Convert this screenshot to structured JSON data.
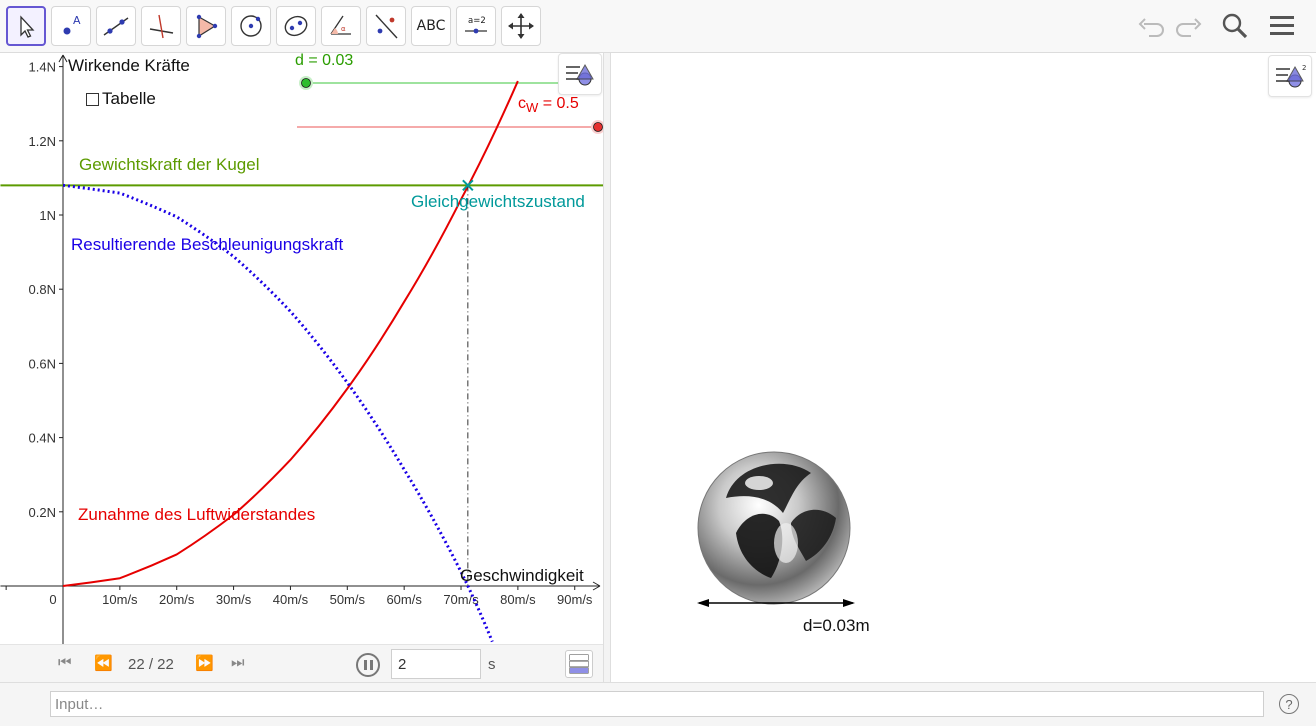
{
  "toolbar": {
    "tools": [
      {
        "name": "move-tool",
        "icon": "arrow-cursor-icon"
      },
      {
        "name": "point-tool",
        "icon": "point-icon",
        "label": "A"
      },
      {
        "name": "line-tool",
        "icon": "line-icon"
      },
      {
        "name": "perpendicular-line-tool",
        "icon": "perpendicular-line-icon"
      },
      {
        "name": "polygon-tool",
        "icon": "polygon-icon"
      },
      {
        "name": "circle-tool",
        "icon": "circle-icon"
      },
      {
        "name": "ellipse-tool",
        "icon": "ellipse-icon"
      },
      {
        "name": "angle-tool",
        "icon": "angle-icon"
      },
      {
        "name": "reflect-tool",
        "icon": "reflect-icon"
      },
      {
        "name": "text-tool",
        "icon": "text-icon",
        "label": "ABC"
      },
      {
        "name": "slider-tool",
        "icon": "slider-icon",
        "label": "a=2"
      },
      {
        "name": "move-graphics-view-tool",
        "icon": "move-view-icon"
      }
    ],
    "right": [
      "undo-icon",
      "redo-icon",
      "search-icon",
      "menu-icon"
    ]
  },
  "graphics1": {
    "title": "Wirkende Kräfte",
    "checkbox_label": "Tabelle",
    "checkbox_checked": false,
    "slider_d_label": "d = 0.03",
    "slider_cw_label": "c",
    "slider_cw_sub": "W",
    "slider_cw_value": " = 0.5",
    "label_weight": "Gewichtskraft der Kugel",
    "label_equilibrium": "Gleichgewichtszustand",
    "label_resultant": "Resultierende Beschleunigungskraft",
    "label_drag": "Zunahme des Luftwiderstandes",
    "x_axis_label": "Geschwindigkeit",
    "colors": {
      "weight": "#5c9b00",
      "drag": "#e60000",
      "resultant": "#1a00e6",
      "equilibrium": "#00999a"
    }
  },
  "chart_data": {
    "type": "line",
    "title": "Wirkende Kräfte",
    "xlabel": "Geschwindigkeit",
    "ylabel": "",
    "x_unit": "m/s",
    "y_unit": "N",
    "x_ticks": [
      "10m/s",
      "20m/s",
      "30m/s",
      "40m/s",
      "50m/s",
      "60m/s",
      "70m/s",
      "80m/s",
      "90m/s"
    ],
    "x_tick_values": [
      10,
      20,
      30,
      40,
      50,
      60,
      70,
      80,
      90
    ],
    "y_ticks": [
      "0.2N",
      "0.4N",
      "0.6N",
      "0.8N",
      "1N",
      "1.2N",
      "1.4N"
    ],
    "y_tick_values": [
      0.2,
      0.4,
      0.6,
      0.8,
      1.0,
      1.2,
      1.4
    ],
    "origin_label": "0",
    "xlim": [
      -11,
      95
    ],
    "ylim": [
      -0.15,
      1.43
    ],
    "series": [
      {
        "name": "Gewichtskraft der Kugel",
        "style": "solid",
        "color": "#5c9b00",
        "x": [
          -11,
          95
        ],
        "y": [
          1.08,
          1.08
        ]
      },
      {
        "name": "Zunahme des Luftwiderstandes",
        "style": "solid",
        "color": "#e60000",
        "x": [
          0,
          10,
          20,
          30,
          40,
          50,
          60,
          70,
          80
        ],
        "y": [
          0,
          0.021,
          0.085,
          0.192,
          0.34,
          0.532,
          0.766,
          1.042,
          1.361
        ]
      },
      {
        "name": "Resultierende Beschleunigungskraft",
        "style": "dotted",
        "color": "#1a00e6",
        "x": [
          0,
          10,
          20,
          30,
          40,
          50,
          60,
          70,
          75.5
        ],
        "y": [
          1.08,
          1.059,
          0.995,
          0.888,
          0.74,
          0.548,
          0.314,
          0.038,
          -0.15
        ]
      }
    ],
    "equilibrium_point": {
      "x": 71.2,
      "y": 1.08,
      "label": "Gleichgewichtszustand"
    },
    "sliders": [
      {
        "name": "d",
        "value": 0.03,
        "color": "#2dbd2d"
      },
      {
        "name": "cW",
        "value": 0.5,
        "color": "#e63030"
      }
    ]
  },
  "graphics2": {
    "ball_label": "d=0.03m"
  },
  "animation": {
    "count": "22 / 22",
    "speed_value": "2",
    "speed_unit": "s"
  },
  "input_bar": {
    "placeholder": "Input…",
    "help": "?"
  }
}
